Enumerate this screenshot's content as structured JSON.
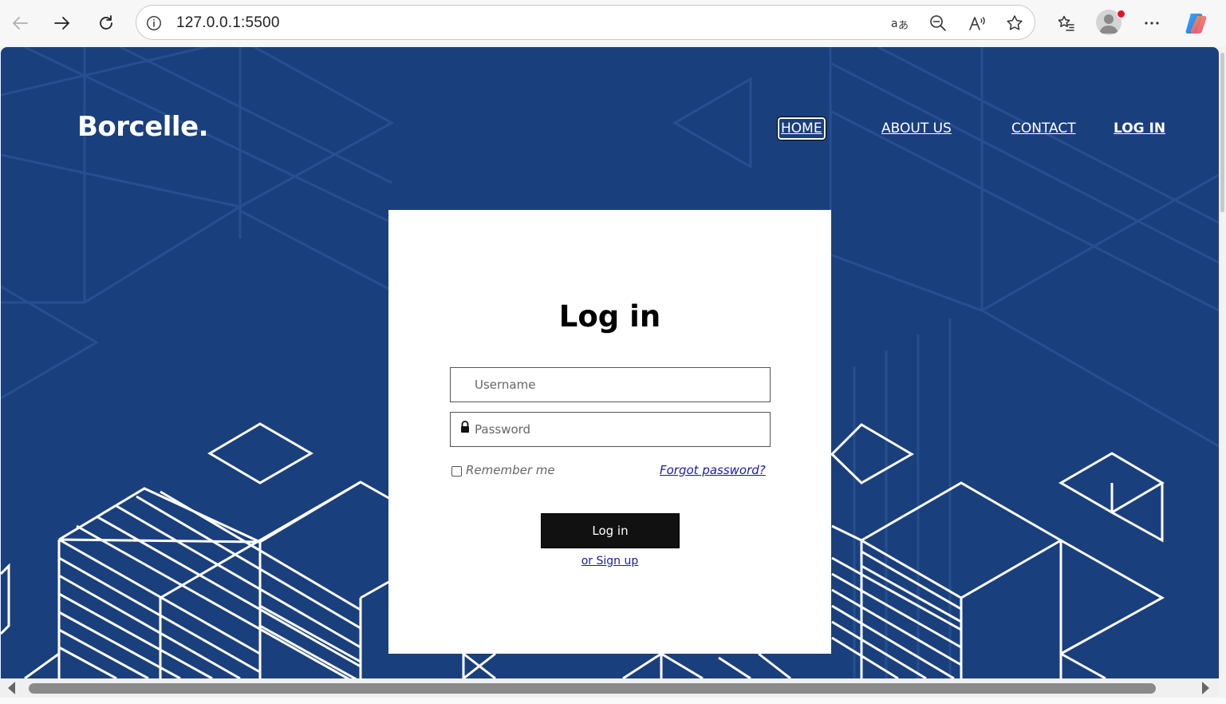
{
  "browser": {
    "url": "127.0.0.1:5500",
    "icons": {
      "back": "back-arrow-icon",
      "forward": "forward-arrow-icon",
      "refresh": "refresh-icon",
      "site_info": "info-icon",
      "translate": "translate-icon",
      "zoom_out": "zoom-out-icon",
      "read_aloud": "read-aloud-icon",
      "favorite": "star-icon",
      "favorites_list": "favorites-icon",
      "profile": "avatar",
      "more": "more-icon",
      "copilot": "copilot-icon"
    }
  },
  "site": {
    "logo": "Borcelle.",
    "nav": {
      "home": "HOME",
      "about": "ABOUT US",
      "contact": "CONTACT",
      "login": "LOG IN"
    }
  },
  "login": {
    "title": "Log in",
    "username_placeholder": "Username",
    "password_placeholder": "Password",
    "remember_label": "Remember me",
    "forgot_link": "Forgot password?",
    "submit_label": "Log in",
    "signup_link": "or Sign up"
  },
  "colors": {
    "page_background": "#1a3f7d",
    "card_background": "#ffffff",
    "button_background": "#111111",
    "link": "#1a1aa6"
  }
}
